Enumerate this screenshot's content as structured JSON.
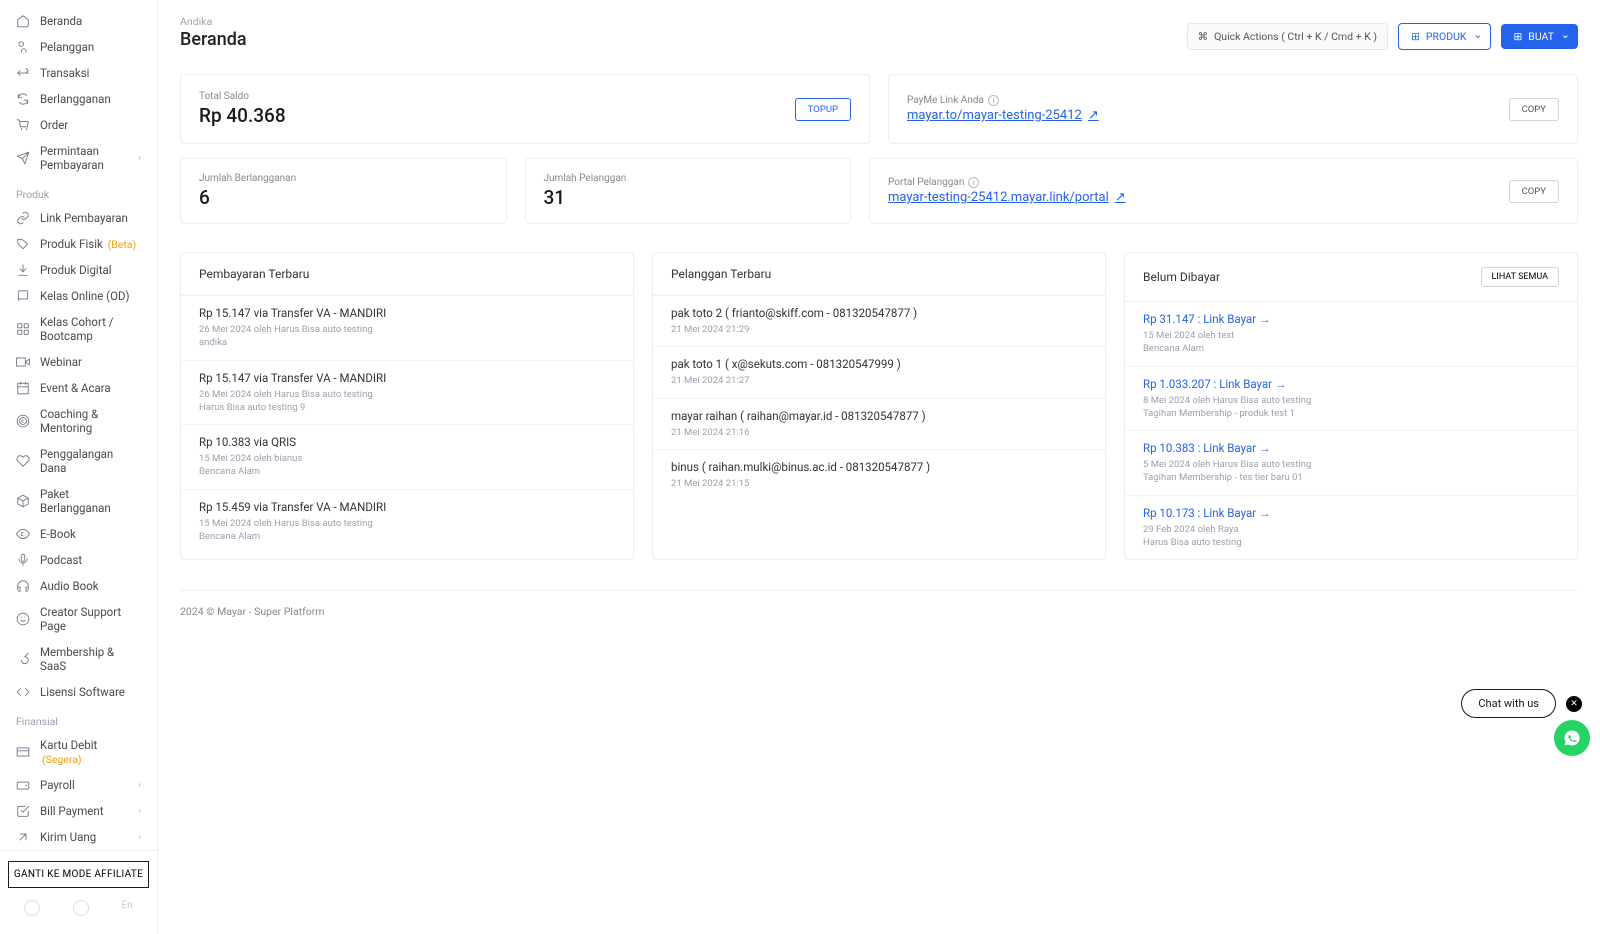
{
  "sidebar": {
    "nav_main": [
      {
        "icon": "home",
        "label": "Beranda"
      },
      {
        "icon": "users",
        "label": "Pelanggan"
      },
      {
        "icon": "arrows",
        "label": "Transaksi"
      },
      {
        "icon": "refresh",
        "label": "Berlangganan"
      },
      {
        "icon": "cart",
        "label": "Order"
      },
      {
        "icon": "send",
        "label": "Permintaan Pembayaran",
        "chev": true
      }
    ],
    "section_produk": "Produk",
    "nav_produk": [
      {
        "icon": "link",
        "label": "Link Pembayaran"
      },
      {
        "icon": "tag",
        "label": "Produk Fisik",
        "badge": "(Beta)"
      },
      {
        "icon": "download",
        "label": "Produk Digital"
      },
      {
        "icon": "book",
        "label": "Kelas Online (OD)"
      },
      {
        "icon": "grid",
        "label": "Kelas Cohort / Bootcamp"
      },
      {
        "icon": "video",
        "label": "Webinar"
      },
      {
        "icon": "calendar",
        "label": "Event & Acara"
      },
      {
        "icon": "target",
        "label": "Coaching & Mentoring"
      },
      {
        "icon": "heart",
        "label": "Penggalangan Dana"
      },
      {
        "icon": "package",
        "label": "Paket Berlangganan"
      },
      {
        "icon": "eye",
        "label": "E-Book"
      },
      {
        "icon": "mic",
        "label": "Podcast"
      },
      {
        "icon": "headphones",
        "label": "Audio Book"
      },
      {
        "icon": "smile",
        "label": "Creator Support Page"
      },
      {
        "icon": "key",
        "label": "Membership & SaaS"
      },
      {
        "icon": "code",
        "label": "Lisensi Software"
      }
    ],
    "section_finansial": "Finansial",
    "nav_finansial": [
      {
        "icon": "card",
        "label": "Kartu Debit",
        "badge": "(Segera)"
      },
      {
        "icon": "wallet",
        "label": "Payroll",
        "chev": true
      },
      {
        "icon": "check",
        "label": "Bill Payment",
        "chev": true
      },
      {
        "icon": "arrow",
        "label": "Kirim Uang",
        "chev": true
      }
    ],
    "affiliate_btn": "GANTI KE MODE AFFILIATE"
  },
  "header": {
    "breadcrumb": "Andika",
    "title": "Beranda",
    "quick_actions": "Quick Actions ( Ctrl + K / Cmd + K )",
    "produk_btn": "PRODUK",
    "buat_btn": "BUAT"
  },
  "cards": {
    "saldo": {
      "label": "Total Saldo",
      "value": "Rp 40.368",
      "btn": "TOPUP"
    },
    "payme": {
      "label": "PayMe Link Anda",
      "link": "mayar.to/mayar-testing-25412",
      "btn": "COPY"
    },
    "berlangganan": {
      "label": "Jumlah Berlangganan",
      "value": "6"
    },
    "pelanggan": {
      "label": "Jumlah Pelanggan",
      "value": "31"
    },
    "portal": {
      "label": "Portal Pelanggan",
      "link": "mayar-testing-25412.mayar.link/portal",
      "btn": "COPY"
    }
  },
  "cols": {
    "payments": {
      "title": "Pembayaran Terbaru",
      "items": [
        {
          "line": "Rp 15.147 via Transfer VA - MANDIRI",
          "meta1": "26 Mei 2024 oleh Harus Bisa auto testing",
          "meta2": "andika"
        },
        {
          "line": "Rp 15.147 via Transfer VA - MANDIRI",
          "meta1": "26 Mei 2024 oleh Harus Bisa auto testing",
          "meta2": "Harus Bisa auto testing 9"
        },
        {
          "line": "Rp 10.383 via QRIS",
          "meta1": "15 Mei 2024 oleh bianus",
          "meta2": "Bencana Alam"
        },
        {
          "line": "Rp 15.459 via Transfer VA - MANDIRI",
          "meta1": "15 Mei 2024 oleh Harus Bisa auto testing",
          "meta2": "Bencana Alam"
        }
      ]
    },
    "customers": {
      "title": "Pelanggan Terbaru",
      "items": [
        {
          "line": "pak toto 2 ( frianto@skiff.com - 081320547877 )",
          "meta1": "21 Mei 2024 21:29"
        },
        {
          "line": "pak toto 1 ( x@sekuts.com - 081320547999 )",
          "meta1": "21 Mei 2024 21:27"
        },
        {
          "line": "mayar raihan ( raihan@mayar.id - 081320547877 )",
          "meta1": "21 Mei 2024 21:16"
        },
        {
          "line": "binus ( raihan.mulki@binus.ac.id - 081320547877 )",
          "meta1": "21 Mei 2024 21:15"
        }
      ]
    },
    "unpaid": {
      "title": "Belum Dibayar",
      "see_all": "LIHAT SEMUA",
      "items": [
        {
          "amount": "Rp 31.147",
          "link_label": "Link Bayar →",
          "meta1": "15 Mei 2024 oleh test",
          "meta2": "Bencana Alam"
        },
        {
          "amount": "Rp 1.033.207",
          "link_label": "Link Bayar →",
          "meta1": "8 Mei 2024 oleh Harus Bisa auto testing",
          "meta2": "Tagihan Membership - produk test 1"
        },
        {
          "amount": "Rp 10.383",
          "link_label": "Link Bayar →",
          "meta1": "5 Mei 2024 oleh Harus Bisa auto testing",
          "meta2": "Tagihan Membership - tes tier baru 01"
        },
        {
          "amount": "Rp 10.173",
          "link_label": "Link Bayar →",
          "meta1": "29 Feb 2024 oleh Raya",
          "meta2": "Harus Bisa auto testing"
        }
      ]
    }
  },
  "footer": "2024 © Mayar - Super Platform",
  "chat": {
    "label": "Chat with us"
  }
}
